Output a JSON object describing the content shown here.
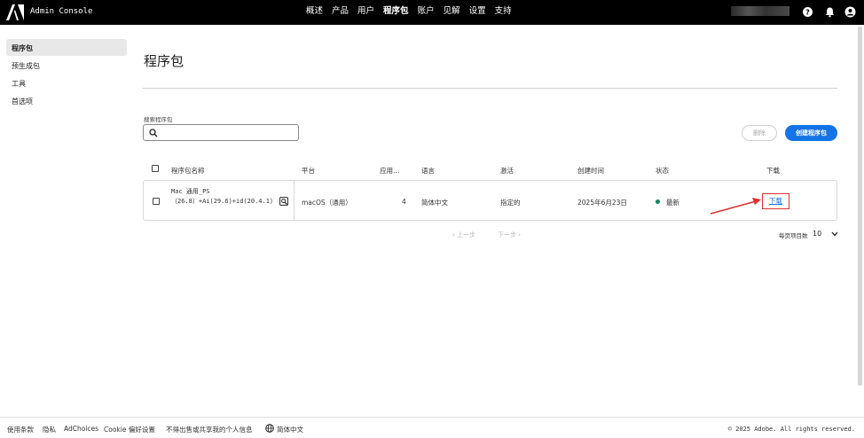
{
  "header": {
    "app_title": "Admin Console",
    "nav": [
      "概述",
      "产品",
      "用户",
      "程序包",
      "账户",
      "见解",
      "设置",
      "支持"
    ],
    "active_nav": "程序包",
    "icons": [
      "help-icon",
      "bell-icon",
      "avatar-icon"
    ]
  },
  "sidebar": {
    "items": [
      {
        "label": "程序包",
        "active": true
      },
      {
        "label": "预生成包",
        "active": false
      },
      {
        "label": "工具",
        "active": false
      },
      {
        "label": "首选项",
        "active": false
      }
    ]
  },
  "main": {
    "title": "程序包",
    "search_label": "搜索程序包",
    "search_value": "",
    "delete_label": "删除",
    "create_label": "创建程序包",
    "columns": [
      "程序包名称",
      "平台",
      "应用…",
      "语言",
      "激活",
      "创建时间",
      "状态",
      "下载"
    ],
    "rows": [
      {
        "name": "Mac 通用_PS （26.8）+Ai(29.6)+id(20.4.1)",
        "platform": "macOS（通用）",
        "apps": "4",
        "language": "简体中文",
        "activation": "指定的",
        "created": "2025年6月23日",
        "status": "最新",
        "download": "下载"
      }
    ],
    "pager": {
      "prev": "上一步",
      "next": "下一步"
    },
    "per_page_label": "每页项目数",
    "per_page_value": "10"
  },
  "footer": {
    "links": [
      "使用条款",
      "隐私",
      "AdChoices",
      "Cookie 偏好设置",
      "不得出售或共享我的个人信息",
      "简体中文"
    ],
    "copyright": "© 2025 Adobe. All rights reserved."
  },
  "colors": {
    "accent": "#1473e6",
    "status_ok": "#12805c",
    "annotation": "#e03030"
  }
}
